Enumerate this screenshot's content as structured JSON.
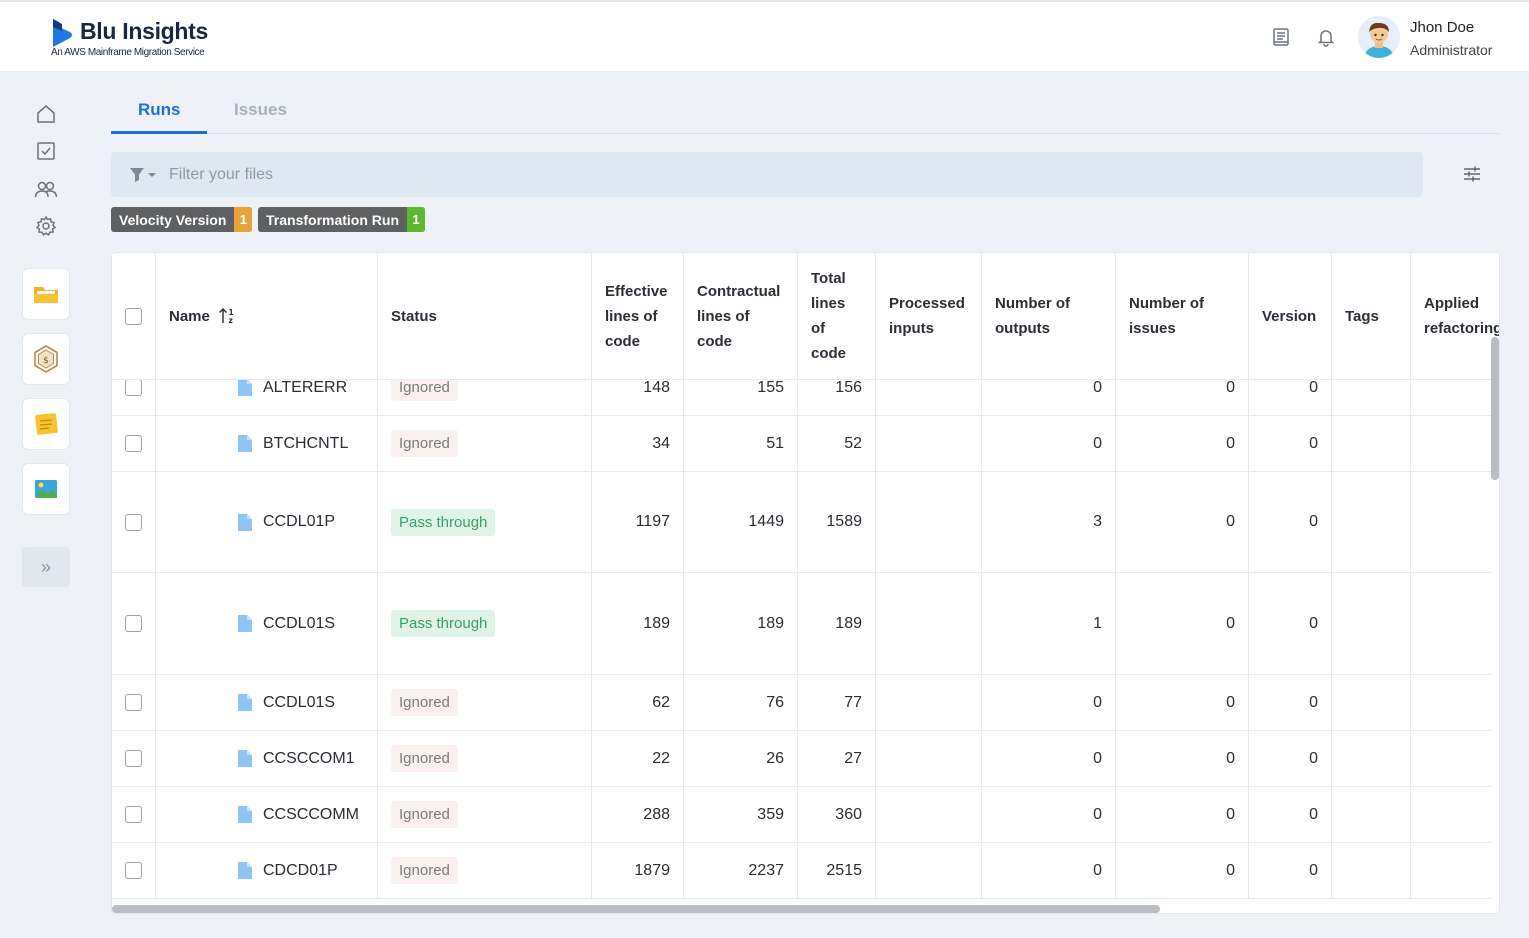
{
  "app": {
    "name": "Blu Insights",
    "subtitle": "An AWS Mainframe Migration Service"
  },
  "header": {
    "icons": [
      "book-icon",
      "bell-icon"
    ],
    "user": {
      "name": "Jhon Doe",
      "role": "Administrator"
    }
  },
  "sidebar": {
    "nav_icons": [
      "home-icon",
      "checklist-icon",
      "users-icon",
      "gear-icon"
    ],
    "app_icons": [
      "folder-app-icon",
      "hexagon-dollar-app-icon",
      "notes-app-icon",
      "image-app-icon"
    ],
    "expand_label": "»"
  },
  "tabs": [
    {
      "label": "Runs",
      "active": true
    },
    {
      "label": "Issues",
      "active": false
    }
  ],
  "filter": {
    "placeholder": "Filter your files"
  },
  "chips": [
    {
      "label": "Velocity Version",
      "count": "1",
      "color": "#e8a23a"
    },
    {
      "label": "Transformation Run",
      "count": "1",
      "color": "#5cb82e"
    }
  ],
  "table": {
    "columns": [
      "Name",
      "Status",
      "Effective lines of code",
      "Contractual lines of code",
      "Total lines of code",
      "Processed inputs",
      "Number of outputs",
      "Number of issues",
      "Version",
      "Tags",
      "Applied refactoring"
    ],
    "rows": [
      {
        "name": "ALTERERR",
        "status": "Ignored",
        "effective": "148",
        "contractual": "155",
        "total": "156",
        "processed": "",
        "outputs": "0",
        "issues": "0",
        "version": "0"
      },
      {
        "name": "BTCHCNTL",
        "status": "Ignored",
        "effective": "34",
        "contractual": "51",
        "total": "52",
        "processed": "",
        "outputs": "0",
        "issues": "0",
        "version": "0"
      },
      {
        "name": "CCDL01P",
        "status": "Pass through",
        "effective": "1197",
        "contractual": "1449",
        "total": "1589",
        "processed": "",
        "outputs": "3",
        "issues": "0",
        "version": "0"
      },
      {
        "name": "CCDL01S",
        "status": "Pass through",
        "effective": "189",
        "contractual": "189",
        "total": "189",
        "processed": "",
        "outputs": "1",
        "issues": "0",
        "version": "0"
      },
      {
        "name": "CCDL01S",
        "status": "Ignored",
        "effective": "62",
        "contractual": "76",
        "total": "77",
        "processed": "",
        "outputs": "0",
        "issues": "0",
        "version": "0"
      },
      {
        "name": "CCSCCOM1",
        "status": "Ignored",
        "effective": "22",
        "contractual": "26",
        "total": "27",
        "processed": "",
        "outputs": "0",
        "issues": "0",
        "version": "0"
      },
      {
        "name": "CCSCCOMM",
        "status": "Ignored",
        "effective": "288",
        "contractual": "359",
        "total": "360",
        "processed": "",
        "outputs": "0",
        "issues": "0",
        "version": "0"
      },
      {
        "name": "CDCD01P",
        "status": "Ignored",
        "effective": "1879",
        "contractual": "2237",
        "total": "2515",
        "processed": "",
        "outputs": "0",
        "issues": "0",
        "version": "0"
      }
    ]
  },
  "colors": {
    "accent": "#1f6fd8",
    "pass": "#38a06a",
    "ignored": "#7c7c7c"
  }
}
